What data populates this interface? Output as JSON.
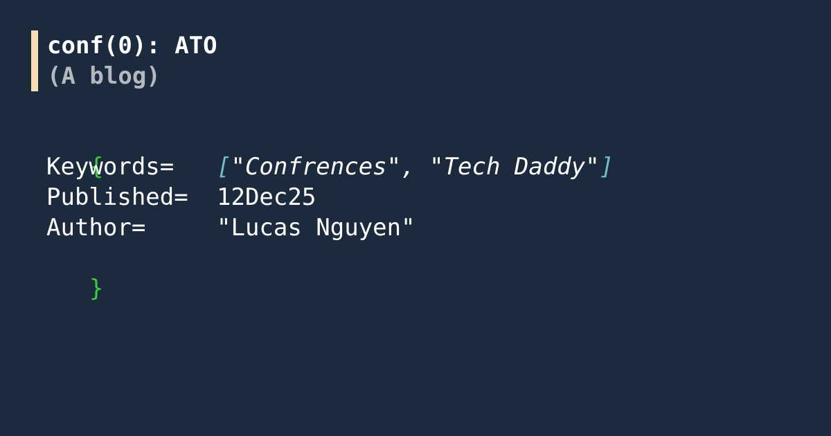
{
  "header": {
    "title": "conf(0): ATO",
    "subtitle": "(A blog)"
  },
  "code": {
    "open_brace": "{",
    "close_brace": "}",
    "keywords": {
      "key": "Keywords=",
      "open_bracket": "[",
      "items": [
        "\"Confrences\"",
        "\"Tech Daddy\""
      ],
      "separator": ", ",
      "close_bracket": "]"
    },
    "published": {
      "key": "Published=",
      "value": "12Dec25"
    },
    "author": {
      "key": "Author=",
      "value": "\"Lucas Nguyen\""
    }
  },
  "colors": {
    "background": "#1b2a3d",
    "accent_bar": "#f5deb3",
    "brace": "#3ccc3c",
    "bracket": "#72bbc4",
    "subtitle": "#b4b8bf"
  }
}
